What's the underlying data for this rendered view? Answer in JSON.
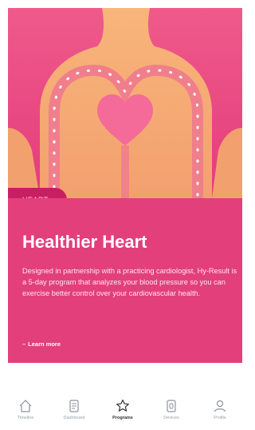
{
  "card": {
    "tag": "HEART",
    "title": "Healthier Heart",
    "description": "Designed in partnership with a practicing cardiologist, Hy-Result is a 5-day program that analyzes your blood pressure so you can exercise better control over your cardiovascular health.",
    "learn_more_prefix": "–",
    "learn_more": "Learn more"
  },
  "nav": {
    "items": [
      {
        "label": "Timeline",
        "icon": "home-icon"
      },
      {
        "label": "Dashboard",
        "icon": "document-icon"
      },
      {
        "label": "Programs",
        "icon": "star-icon"
      },
      {
        "label": "Devices",
        "icon": "watch-icon"
      },
      {
        "label": "Profile",
        "icon": "user-icon"
      }
    ]
  },
  "colors": {
    "accent": "#e33f7b",
    "tag_bg": "#c81f62",
    "hero_bg": "#f35a8b",
    "body_skin": "#f7b27a",
    "heart": "#f46b9a"
  }
}
